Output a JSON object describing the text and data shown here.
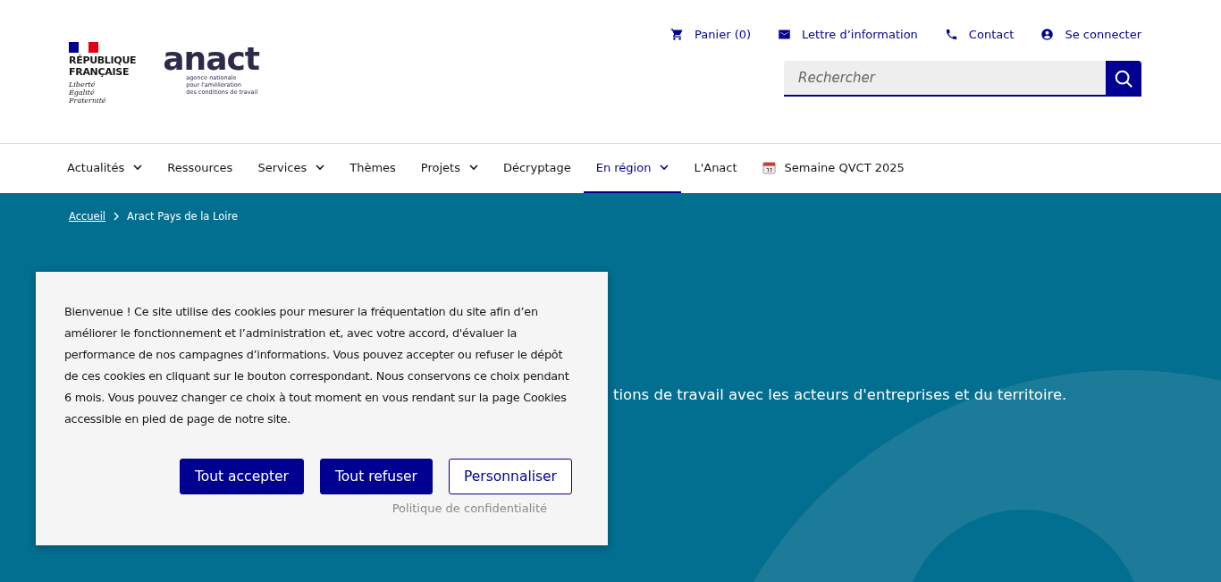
{
  "header": {
    "republic": {
      "name_lines": [
        "RÉPUBLIQUE",
        "FRANÇAISE"
      ],
      "motto_lines": [
        "Liberté",
        "Égalité",
        "Fraternité"
      ]
    },
    "logo": {
      "word": "anact",
      "tagline_lines": [
        "agence nationale",
        "pour l'amélioration",
        "des conditions de travail"
      ]
    },
    "quick_links": [
      {
        "label": "Panier (0)"
      },
      {
        "label": "Lettre d’information"
      },
      {
        "label": "Contact"
      },
      {
        "label": "Se connecter"
      }
    ],
    "search": {
      "placeholder": "Rechercher"
    }
  },
  "nav": [
    {
      "label": "Actualités",
      "dropdown": true,
      "selected": false
    },
    {
      "label": "Ressources",
      "dropdown": false,
      "selected": false
    },
    {
      "label": "Services",
      "dropdown": true,
      "selected": false
    },
    {
      "label": "Thèmes",
      "dropdown": false,
      "selected": false
    },
    {
      "label": "Projets",
      "dropdown": true,
      "selected": false
    },
    {
      "label": "Décryptage",
      "dropdown": false,
      "selected": false
    },
    {
      "label": "En région",
      "dropdown": true,
      "selected": true
    },
    {
      "label": "L'Anact",
      "dropdown": false,
      "selected": false
    },
    {
      "label": "Semaine QVCT 2025",
      "kind": "event",
      "dropdown": false,
      "selected": false
    }
  ],
  "breadcrumb": [
    {
      "label": "Accueil",
      "link": true
    },
    {
      "label": "Aract Pays de la Loire",
      "link": false
    }
  ],
  "hero": {
    "text": "tions de travail avec les acteurs d'entreprises et du territoire."
  },
  "cookie_banner": {
    "message": "Bienvenue ! Ce site utilise des cookies pour mesurer la fréquentation du site afin d’en améliorer le fonctionnement et l’administration et, avec votre accord, d'évaluer la performance de nos campagnes d’informations. Vous pouvez accepter ou refuser le dépôt de ces cookies en cliquant sur le bouton correspondant. Nous conservons ce choix pendant 6 mois. Vous pouvez changer ce choix à tout moment en vous rendant sur la page Cookies accessible en pied de page de notre site.",
    "buttons": [
      {
        "label": "Tout accepter",
        "kind": "primary"
      },
      {
        "label": "Tout refuser",
        "kind": "primary"
      },
      {
        "label": "Personnaliser",
        "kind": "outline"
      }
    ],
    "privacy_link": "Politique de confidentialité"
  }
}
